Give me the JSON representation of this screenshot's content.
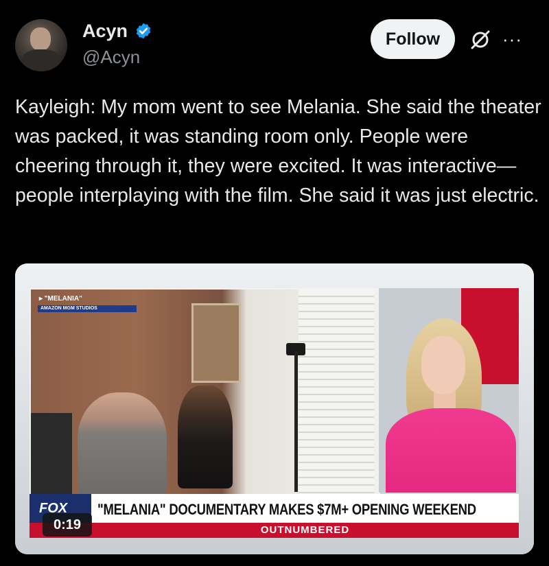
{
  "author": {
    "name": "Acyn",
    "handle": "@Acyn",
    "verified_color": "#1d9bf0"
  },
  "header": {
    "follow_label": "Follow",
    "grok_icon": "grok-icon",
    "more_icon_text": "···"
  },
  "tweet": {
    "text": "Kayleigh: My mom went to see Melania. She said the theater was packed, it was standing room only. People were cheering through it, they were excited. It was interactive—people interplaying with the film. She said it was just electric."
  },
  "media": {
    "duration": "0:19",
    "inset_title": "▸ \"MELANIA\"",
    "inset_subtitle": "AMAZON MGM STUDIOS",
    "network_logo": "FOX",
    "headline": "\"MELANIA\" DOCUMENTARY MAKES $7M+ OPENING WEEKEND",
    "show_name": "OUTNUMBERED"
  }
}
